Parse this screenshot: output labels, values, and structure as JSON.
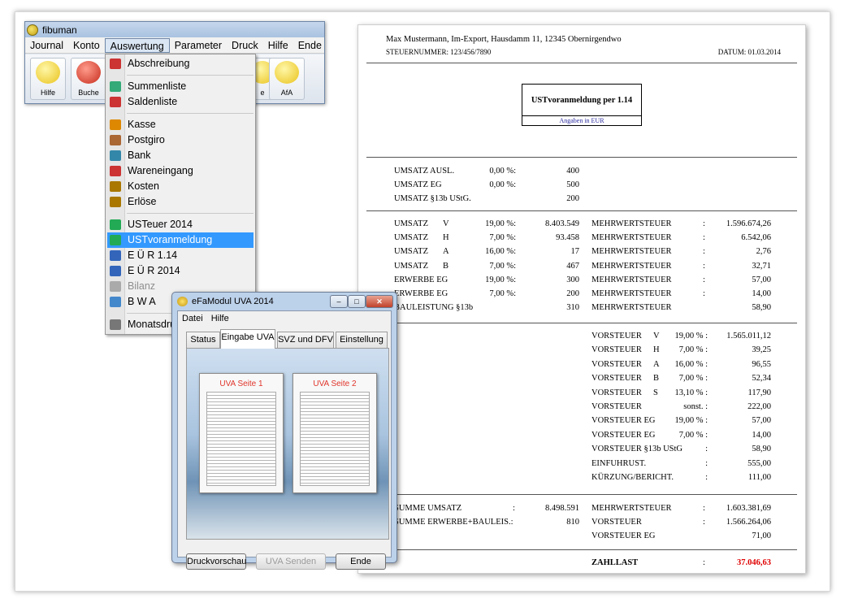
{
  "app": {
    "title": "fibuman",
    "menu": [
      "Journal",
      "Konto",
      "Auswertung",
      "Parameter",
      "Druck",
      "Hilfe",
      "Ende"
    ],
    "toolbar": [
      "Hilfe",
      "Buche",
      "e",
      "AfA"
    ]
  },
  "dropdown": {
    "items": [
      {
        "label": "Abschreibung",
        "icon": "depreciation-icon"
      },
      {
        "label": "Summenliste",
        "icon": "sum-list-icon"
      },
      {
        "label": "Saldenliste",
        "icon": "balance-list-icon"
      },
      {
        "label": "Kasse",
        "icon": "cash-icon"
      },
      {
        "label": "Postgiro",
        "icon": "postgiro-icon"
      },
      {
        "label": "Bank",
        "icon": "bank-icon"
      },
      {
        "label": "Wareneingang",
        "icon": "cart-icon"
      },
      {
        "label": "Kosten",
        "icon": "costs-icon"
      },
      {
        "label": "Erlöse",
        "icon": "revenue-icon"
      },
      {
        "label": "USTeuer 2014",
        "icon": "euro-icon"
      },
      {
        "label": "USTvoranmeldung",
        "icon": "euro-icon"
      },
      {
        "label": "E Ü R 1.14",
        "icon": "chart-icon"
      },
      {
        "label": "E Ü R 2014",
        "icon": "chart-icon"
      },
      {
        "label": "Bilanz",
        "icon": "balance-sheet-icon"
      },
      {
        "label": "B W A",
        "icon": "bwa-icon"
      },
      {
        "label": "Monatsdru",
        "icon": "monthly-print-icon"
      }
    ]
  },
  "dialog": {
    "title": "eFaModul UVA 2014",
    "menu": [
      "Datei",
      "Hilfe"
    ],
    "tabs": [
      "Status",
      "Eingabe UVA",
      "SVZ und DFV",
      "Einstellung"
    ],
    "pages": [
      "UVA Seite 1",
      "UVA Seite 2"
    ],
    "buttons": [
      "Druckvorschau",
      "UVA Senden",
      "Ende"
    ]
  },
  "report": {
    "company": "Max Mustermann, Im-Export, Hausdamm 11, 12345 Obernirgendwo",
    "taxno": "STEUERNUMMER: 123/456/7890",
    "date": "DATUM: 01.03.2014",
    "title": "USTvoranmeldung per  1.14",
    "subtitle": "Angaben in EUR",
    "section1": [
      {
        "label": "UMSATZ AUSL.",
        "pct": "0,00 %:",
        "value": "400"
      },
      {
        "label": "UMSATZ EG",
        "pct": "0,00 %:",
        "value": "500"
      },
      {
        "label": "UMSATZ §13b UStG.",
        "pct": "",
        "value": "200"
      }
    ],
    "section2": [
      {
        "label": "UMSATZ",
        "code": "V",
        "pct": "19,00 %:",
        "value": "8.403.549",
        "tax_label": "MEHRWERTSTEUER",
        "colon": ":",
        "tax": "1.596.674,26"
      },
      {
        "label": "UMSATZ",
        "code": "H",
        "pct": "7,00 %:",
        "value": "93.458",
        "tax_label": "MEHRWERTSTEUER",
        "colon": ":",
        "tax": "6.542,06"
      },
      {
        "label": "UMSATZ",
        "code": "A",
        "pct": "16,00 %:",
        "value": "17",
        "tax_label": "MEHRWERTSTEUER",
        "colon": ":",
        "tax": "2,76"
      },
      {
        "label": "UMSATZ",
        "code": "B",
        "pct": "7,00 %:",
        "value": "467",
        "tax_label": "MEHRWERTSTEUER",
        "colon": ":",
        "tax": "32,71"
      },
      {
        "label": "ERWERBE EG",
        "code": "",
        "pct": "19,00 %:",
        "value": "300",
        "tax_label": "MEHRWERTSTEUER",
        "colon": ":",
        "tax": "57,00"
      },
      {
        "label": "ERWERBE EG",
        "code": "",
        "pct": "7,00 %:",
        "value": "200",
        "tax_label": "MEHRWERTSTEUER",
        "colon": ":",
        "tax": "14,00"
      },
      {
        "label": "BAULEISTUNG  §13b",
        "code": "",
        "pct": "",
        "value": "310",
        "tax_label": "MEHRWERTSTEUER",
        "colon": "",
        "tax": "58,90"
      }
    ],
    "section3": [
      {
        "label": "VORSTEUER",
        "code": "V",
        "pct": "19,00 % :",
        "value": "1.565.011,12"
      },
      {
        "label": "VORSTEUER",
        "code": "H",
        "pct": "7,00 % :",
        "value": "39,25"
      },
      {
        "label": "VORSTEUER",
        "code": "A",
        "pct": "16,00 % :",
        "value": "96,55"
      },
      {
        "label": "VORSTEUER",
        "code": "B",
        "pct": "7,00 % :",
        "value": "52,34"
      },
      {
        "label": "VORSTEUER",
        "code": "S",
        "pct": "13,10 % :",
        "value": "117,90"
      },
      {
        "label": "VORSTEUER",
        "code": "",
        "pct": "sonst.     :",
        "value": "222,00"
      },
      {
        "label": "VORSTEUER EG",
        "code": "",
        "pct": "19,00 % :",
        "value": "57,00"
      },
      {
        "label": "VORSTEUER EG",
        "code": "",
        "pct": "7,00 % :",
        "value": "14,00"
      },
      {
        "label": "VORSTEUER §13b UStG",
        "code": "",
        "pct": ":",
        "value": "58,90"
      },
      {
        "label": "EINFUHRUST.",
        "code": "",
        "pct": ":",
        "value": "555,00"
      },
      {
        "label": "KÜRZUNG/BERICHT.",
        "code": "",
        "pct": ":",
        "value": "111,00"
      }
    ],
    "section4_left": [
      {
        "label": "SUMME UMSATZ",
        "colon": ":",
        "value": "8.498.591"
      },
      {
        "label": "SUMME ERWERBE+BAULEIS.:",
        "colon": "",
        "value": "810"
      }
    ],
    "section4_right": [
      {
        "label": "MEHRWERTSTEUER",
        "colon": ":",
        "value": "1.603.381,69"
      },
      {
        "label": "VORSTEUER",
        "colon": ":",
        "value": "1.566.264,06"
      },
      {
        "label": "VORSTEUER EG",
        "colon": "",
        "value": "71,00"
      }
    ],
    "total": {
      "label": "ZAHLLAST",
      "colon": ":",
      "value": "37.046,63"
    },
    "accent": "#e00000"
  }
}
